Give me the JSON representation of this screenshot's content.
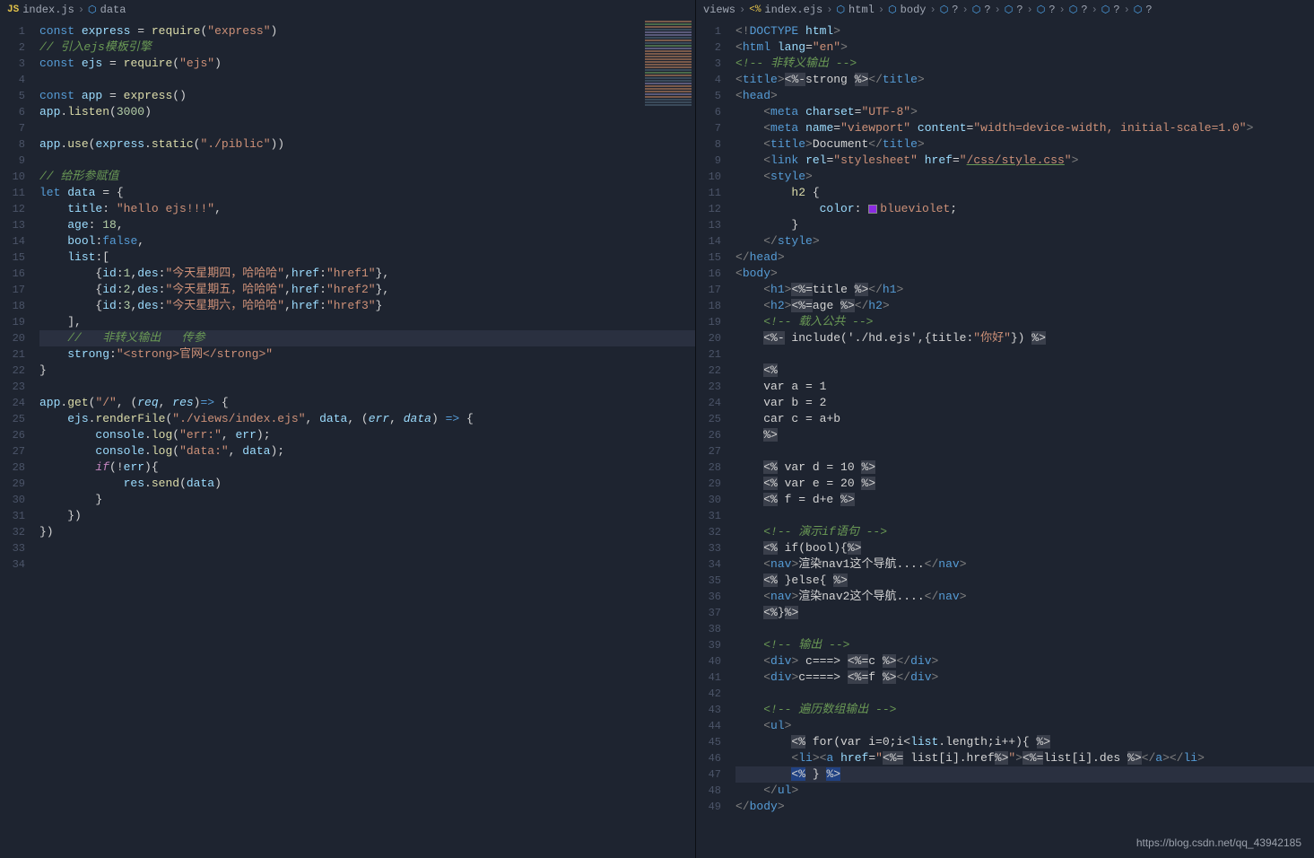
{
  "watermark": "https://blog.csdn.net/qq_43942185",
  "left": {
    "breadcrumb": [
      {
        "icon": "js",
        "label": "index.js"
      },
      {
        "icon": "cube",
        "label": "data"
      }
    ],
    "lines": [
      {
        "n": 1,
        "html": "<span class='kw2'>const</span> <span class='var'>express</span> <span class='op'>=</span> <span class='fn'>require</span>(<span class='str'>\"express\"</span>)"
      },
      {
        "n": 2,
        "html": "<span class='cmt'>// 引入ejs模板引擎</span>"
      },
      {
        "n": 3,
        "html": "<span class='kw2'>const</span> <span class='var'>ejs</span> <span class='op'>=</span> <span class='fn'>require</span>(<span class='str'>\"ejs\"</span>)"
      },
      {
        "n": 4,
        "html": ""
      },
      {
        "n": 5,
        "html": "<span class='kw2'>const</span> <span class='var'>app</span> <span class='op'>=</span> <span class='fn'>express</span>()"
      },
      {
        "n": 6,
        "html": "<span class='var'>app</span>.<span class='fn'>listen</span>(<span class='num'>3000</span>)"
      },
      {
        "n": 7,
        "html": ""
      },
      {
        "n": 8,
        "html": "<span class='var'>app</span>.<span class='fn'>use</span>(<span class='var'>express</span>.<span class='fn'>static</span>(<span class='str'>\"./piblic\"</span>))"
      },
      {
        "n": 9,
        "html": ""
      },
      {
        "n": 10,
        "html": "<span class='cmt'>// 给形参赋值</span>"
      },
      {
        "n": 11,
        "html": "<span class='kw2'>let</span> <span class='var'>data</span> <span class='op'>=</span> <span class='op'>{</span>"
      },
      {
        "n": 12,
        "html": "    <span class='prop'>title</span>: <span class='str'>\"hello ejs!!!\"</span>,"
      },
      {
        "n": 13,
        "html": "    <span class='prop'>age</span>: <span class='num'>18</span>,"
      },
      {
        "n": 14,
        "html": "    <span class='prop'>bool</span>:<span class='kw2'>false</span>,"
      },
      {
        "n": 15,
        "html": "    <span class='prop'>list</span>:["
      },
      {
        "n": 16,
        "html": "        {<span class='prop'>id</span>:<span class='num'>1</span>,<span class='prop'>des</span>:<span class='str'>\"今天星期四，哈哈哈\"</span>,<span class='prop'>href</span>:<span class='str'>\"href1\"</span>},"
      },
      {
        "n": 17,
        "html": "        {<span class='prop'>id</span>:<span class='num'>2</span>,<span class='prop'>des</span>:<span class='str'>\"今天星期五，哈哈哈\"</span>,<span class='prop'>href</span>:<span class='str'>\"href2\"</span>},"
      },
      {
        "n": 18,
        "html": "        {<span class='prop'>id</span>:<span class='num'>3</span>,<span class='prop'>des</span>:<span class='str'>\"今天星期六，哈哈哈\"</span>,<span class='prop'>href</span>:<span class='str'>\"href3\"</span>}"
      },
      {
        "n": 19,
        "html": "    ],"
      },
      {
        "n": 20,
        "html": "    <span class='cmt'>//   非转义输出   传参</span>",
        "hl": true
      },
      {
        "n": 21,
        "html": "    <span class='prop'>strong</span>:<span class='str'>\"&lt;strong&gt;官网&lt;/strong&gt;\"</span>"
      },
      {
        "n": 22,
        "html": "<span class='op'>}</span>"
      },
      {
        "n": 23,
        "html": ""
      },
      {
        "n": 24,
        "html": "<span class='var'>app</span>.<span class='fn'>get</span>(<span class='str'>\"/\"</span>, (<span class='var' style='font-style:italic'>req</span>, <span class='var' style='font-style:italic'>res</span>)<span class='kw2'>=&gt;</span> {"
      },
      {
        "n": 25,
        "html": "    <span class='var'>ejs</span>.<span class='fn'>renderFile</span>(<span class='str'>\"./views/index.ejs\"</span>, <span class='var'>data</span>, (<span class='var' style='font-style:italic'>err</span>, <span class='var' style='font-style:italic'>data</span>) <span class='kw2'>=&gt;</span> {"
      },
      {
        "n": 26,
        "html": "        <span class='var'>console</span>.<span class='fn'>log</span>(<span class='str'>\"err:\"</span>, <span class='var'>err</span>);"
      },
      {
        "n": 27,
        "html": "        <span class='var'>console</span>.<span class='fn'>log</span>(<span class='str'>\"data:\"</span>, <span class='var'>data</span>);"
      },
      {
        "n": 28,
        "html": "        <span class='kw'>if</span>(!<span class='var'>err</span>){"
      },
      {
        "n": 29,
        "html": "            <span class='var'>res</span>.<span class='fn'>send</span>(<span class='var'>data</span>)"
      },
      {
        "n": 30,
        "html": "        }"
      },
      {
        "n": 31,
        "html": "    })"
      },
      {
        "n": 32,
        "html": "})"
      },
      {
        "n": 33,
        "html": ""
      },
      {
        "n": 34,
        "html": ""
      }
    ]
  },
  "right": {
    "breadcrumb": [
      {
        "icon": "",
        "label": "views"
      },
      {
        "icon": "ejs",
        "label": "index.ejs"
      },
      {
        "icon": "cube",
        "label": "html"
      },
      {
        "icon": "cube",
        "label": "body"
      },
      {
        "icon": "cube",
        "label": "?"
      },
      {
        "icon": "cube",
        "label": "?"
      },
      {
        "icon": "cube",
        "label": "?"
      },
      {
        "icon": "cube",
        "label": "?"
      },
      {
        "icon": "cube",
        "label": "?"
      },
      {
        "icon": "cube",
        "label": "?"
      },
      {
        "icon": "cube",
        "label": "?"
      }
    ],
    "lines": [
      {
        "n": 1,
        "html": "<span class='punct'>&lt;!</span><span class='doctype'>DOCTYPE</span> <span class='attr'>html</span><span class='punct'>&gt;</span>"
      },
      {
        "n": 2,
        "html": "<span class='punct'>&lt;</span><span class='tagname'>html</span> <span class='attr'>lang</span>=<span class='str'>\"en\"</span><span class='punct'>&gt;</span>"
      },
      {
        "n": 3,
        "html": "<span class='cmt'>&lt;!-- 非转义输出 --&gt;</span>"
      },
      {
        "n": 4,
        "html": "<span class='punct'>&lt;</span><span class='tagname'>title</span><span class='punct'>&gt;</span><span class='ejsdelim'>&lt;%-</span>strong <span class='ejsdelim'>%&gt;</span><span class='punct'>&lt;/</span><span class='tagname'>title</span><span class='punct'>&gt;</span>"
      },
      {
        "n": 5,
        "html": "<span class='punct'>&lt;</span><span class='tagname'>head</span><span class='punct'>&gt;</span>"
      },
      {
        "n": 6,
        "html": "    <span class='punct'>&lt;</span><span class='tagname'>meta</span> <span class='attr'>charset</span>=<span class='str'>\"UTF-8\"</span><span class='punct'>&gt;</span>"
      },
      {
        "n": 7,
        "html": "    <span class='punct'>&lt;</span><span class='tagname'>meta</span> <span class='attr'>name</span>=<span class='str'>\"viewport\"</span> <span class='attr'>content</span>=<span class='str'>\"width=device-width, initial-scale=1.0\"</span><span class='punct'>&gt;</span>"
      },
      {
        "n": 8,
        "html": "    <span class='punct'>&lt;</span><span class='tagname'>title</span><span class='punct'>&gt;</span>Document<span class='punct'>&lt;/</span><span class='tagname'>title</span><span class='punct'>&gt;</span>"
      },
      {
        "n": 9,
        "html": "    <span class='punct'>&lt;</span><span class='tagname'>link</span> <span class='attr'>rel</span>=<span class='str'>\"stylesheet\"</span> <span class='attr'>href</span>=<span class='str'>\"</span><span class='link'>/css/style.css</span><span class='str'>\"</span><span class='punct'>&gt;</span>"
      },
      {
        "n": 10,
        "html": "    <span class='punct'>&lt;</span><span class='tagname'>style</span><span class='punct'>&gt;</span>"
      },
      {
        "n": 11,
        "html": "        <span class='fn'>h2</span> {"
      },
      {
        "n": 12,
        "html": "            <span class='prop'>color</span>: <span class='colorbox'></span><span class='str'>blueviolet</span>;"
      },
      {
        "n": 13,
        "html": "        }"
      },
      {
        "n": 14,
        "html": "    <span class='punct'>&lt;/</span><span class='tagname'>style</span><span class='punct'>&gt;</span>"
      },
      {
        "n": 15,
        "html": "<span class='punct'>&lt;/</span><span class='tagname'>head</span><span class='punct'>&gt;</span>"
      },
      {
        "n": 16,
        "html": "<span class='punct'>&lt;</span><span class='tagname'>body</span><span class='punct'>&gt;</span>"
      },
      {
        "n": 17,
        "html": "    <span class='punct'>&lt;</span><span class='tagname'>h1</span><span class='punct'>&gt;</span><span class='ejsdelim'>&lt;%=</span>title <span class='ejsdelim'>%&gt;</span><span class='punct'>&lt;/</span><span class='tagname'>h1</span><span class='punct'>&gt;</span>"
      },
      {
        "n": 18,
        "html": "    <span class='punct'>&lt;</span><span class='tagname'>h2</span><span class='punct'>&gt;</span><span class='ejsdelim'>&lt;%=</span>age <span class='ejsdelim'>%&gt;</span><span class='punct'>&lt;/</span><span class='tagname'>h2</span><span class='punct'>&gt;</span>"
      },
      {
        "n": 19,
        "html": "    <span class='cmt'>&lt;!-- 载入公共 --&gt;</span>"
      },
      {
        "n": 20,
        "html": "    <span class='ejsdelim'>&lt;%-</span> include('./hd.ejs',{title:<span class='str'>\"你好\"</span>}) <span class='ejsdelim'>%&gt;</span>"
      },
      {
        "n": 21,
        "html": ""
      },
      {
        "n": 22,
        "html": "    <span class='ejsdelim'>&lt;%</span>"
      },
      {
        "n": 23,
        "html": "    var a = 1"
      },
      {
        "n": 24,
        "html": "    var b = 2"
      },
      {
        "n": 25,
        "html": "    car c = a+b"
      },
      {
        "n": 26,
        "html": "    <span class='ejsdelim'>%&gt;</span>"
      },
      {
        "n": 27,
        "html": ""
      },
      {
        "n": 28,
        "html": "    <span class='ejsdelim'>&lt;%</span> var d = 10 <span class='ejsdelim'>%&gt;</span>"
      },
      {
        "n": 29,
        "html": "    <span class='ejsdelim'>&lt;%</span> var e = 20 <span class='ejsdelim'>%&gt;</span>"
      },
      {
        "n": 30,
        "html": "    <span class='ejsdelim'>&lt;%</span> f = d+e <span class='ejsdelim'>%&gt;</span>"
      },
      {
        "n": 31,
        "html": ""
      },
      {
        "n": 32,
        "html": "    <span class='cmt'>&lt;!-- 演示if语句 --&gt;</span>"
      },
      {
        "n": 33,
        "html": "    <span class='ejsdelim'>&lt;%</span> if(bool){<span class='ejsdelim'>%&gt;</span>"
      },
      {
        "n": 34,
        "html": "    <span class='punct'>&lt;</span><span class='tagname'>nav</span><span class='punct'>&gt;</span>渲染nav1这个导航....<span class='punct'>&lt;/</span><span class='tagname'>nav</span><span class='punct'>&gt;</span>"
      },
      {
        "n": 35,
        "html": "    <span class='ejsdelim'>&lt;%</span> }else{ <span class='ejsdelim'>%&gt;</span>"
      },
      {
        "n": 36,
        "html": "    <span class='punct'>&lt;</span><span class='tagname'>nav</span><span class='punct'>&gt;</span>渲染nav2这个导航....<span class='punct'>&lt;/</span><span class='tagname'>nav</span><span class='punct'>&gt;</span>"
      },
      {
        "n": 37,
        "html": "    <span class='ejsdelim'>&lt;%</span>}<span class='ejsdelim'>%&gt;</span>"
      },
      {
        "n": 38,
        "html": ""
      },
      {
        "n": 39,
        "html": "    <span class='cmt'>&lt;!-- 输出 --&gt;</span>"
      },
      {
        "n": 40,
        "html": "    <span class='punct'>&lt;</span><span class='tagname'>div</span><span class='punct'>&gt;</span> c===&gt; <span class='ejsdelim'>&lt;%=</span>c <span class='ejsdelim'>%&gt;</span><span class='punct'>&lt;/</span><span class='tagname'>div</span><span class='punct'>&gt;</span>"
      },
      {
        "n": 41,
        "html": "    <span class='punct'>&lt;</span><span class='tagname'>div</span><span class='punct'>&gt;</span>c====&gt; <span class='ejsdelim'>&lt;%=</span>f <span class='ejsdelim'>%&gt;</span><span class='punct'>&lt;/</span><span class='tagname'>div</span><span class='punct'>&gt;</span>"
      },
      {
        "n": 42,
        "html": ""
      },
      {
        "n": 43,
        "html": "    <span class='cmt'>&lt;!-- 遍历数组输出 --&gt;</span>"
      },
      {
        "n": 44,
        "html": "    <span class='punct'>&lt;</span><span class='tagname'>ul</span><span class='punct'>&gt;</span>"
      },
      {
        "n": 45,
        "html": "        <span class='ejsdelim'>&lt;%</span> for(var i=0;i&lt;<span class='var'>list</span>.length;i++){ <span class='ejsdelim'>%&gt;</span>"
      },
      {
        "n": 46,
        "html": "        <span class='punct'>&lt;</span><span class='tagname'>li</span><span class='punct'>&gt;</span><span class='punct'>&lt;</span><span class='tagname'>a</span> <span class='attr'>href</span>=<span class='str'>\"</span><span class='ejsdelim'>&lt;%=</span> list[i].href<span class='ejsdelim'>%&gt;</span><span class='str'>\"</span><span class='punct'>&gt;</span><span class='ejsdelim'>&lt;%=</span>list[i].des <span class='ejsdelim'>%&gt;</span><span class='punct'>&lt;/</span><span class='tagname'>a</span><span class='punct'>&gt;</span><span class='punct'>&lt;/</span><span class='tagname'>li</span><span class='punct'>&gt;</span>"
      },
      {
        "n": 47,
        "html": "        <span class='ejsdelim' style='background:#214283'>&lt;%</span> } <span class='ejsdelim' style='background:#214283'>%&gt;</span>",
        "hl": true
      },
      {
        "n": 48,
        "html": "    <span class='punct'>&lt;/</span><span class='tagname'>ul</span><span class='punct'>&gt;</span>"
      },
      {
        "n": 49,
        "html": "<span class='punct'>&lt;/</span><span class='tagname'>body</span><span class='punct'>&gt;</span>"
      }
    ]
  }
}
